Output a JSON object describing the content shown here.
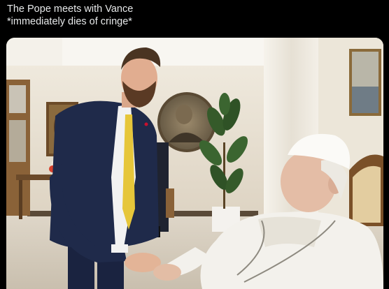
{
  "post": {
    "line1": "The Pope meets with Vance",
    "line2": "*immediately dies of cringe*"
  },
  "colors": {
    "background": "#000000",
    "text": "#e7e9ea",
    "wall": "#e8e2d6",
    "suit": "#1f2a4a",
    "tie": "#e6c63a",
    "cassock": "#f3f1ec"
  },
  "photo": {
    "subject_left": "man in navy suit with yellow tie",
    "subject_right": "man in white cassock and zucchetto, seated"
  }
}
